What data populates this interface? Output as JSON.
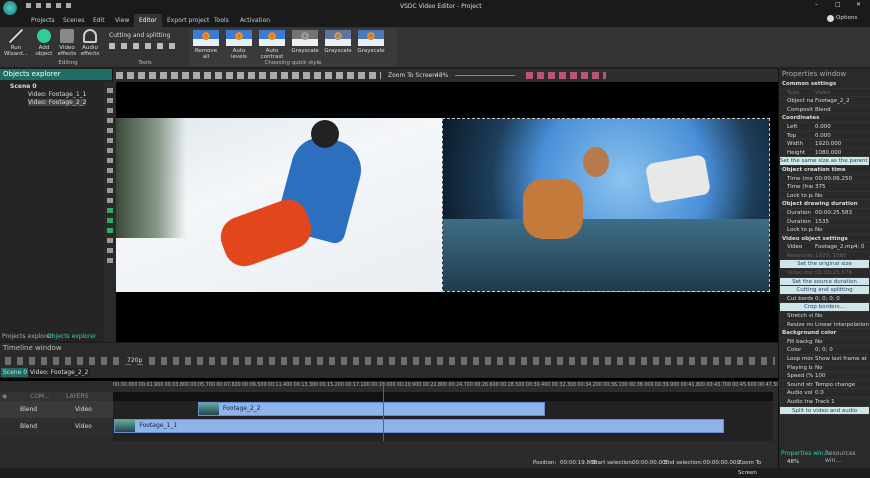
{
  "window": {
    "title": "VSDC Video Editor - Project",
    "options_label": "Options"
  },
  "menu": {
    "tabs": [
      "Projects",
      "Scenes",
      "Edit",
      "View",
      "Editor",
      "Export project",
      "Tools",
      "Activation"
    ],
    "active": "Editor"
  },
  "ribbon": {
    "run_wizard": "Run Wizard...",
    "add_object": "Add object",
    "video_effects": "Video effects",
    "audio_effects": "Audio effects",
    "editing_group": "Editing",
    "cutting": "Cutting and splitting",
    "tools_group": "Tools",
    "quick_styles": [
      "Remove all",
      "Auto levels",
      "Auto contrast",
      "Grayscale",
      "Grayscale",
      "Grayscale"
    ],
    "quick_group": "Choosing quick style"
  },
  "objects_explorer": {
    "title": "Objects explorer",
    "items": [
      "Scene 0",
      "Video: Footage_1_1",
      "Video: Footage_2_2"
    ],
    "tabs": [
      "Projects explorer",
      "Objects explorer"
    ]
  },
  "toolbar": {
    "zoom_label": "Zoom To Screen",
    "zoom_value": "48%"
  },
  "properties": {
    "title": "Properties window",
    "rows": [
      {
        "t": "sec",
        "k": "Common settings"
      },
      {
        "t": "dim",
        "k": "Type",
        "v": "Video"
      },
      {
        "k": "Object name",
        "v": "Footage_2_2"
      },
      {
        "k": "Composition m",
        "v": "Blend"
      },
      {
        "t": "sec",
        "k": "Coordinates"
      },
      {
        "k": "Left",
        "v": "0.000"
      },
      {
        "k": "Top",
        "v": "0.000"
      },
      {
        "k": "Width",
        "v": "1920.000"
      },
      {
        "k": "Height",
        "v": "1080.000"
      },
      {
        "t": "btn",
        "k": "Set the same size as the parent has"
      },
      {
        "t": "sec",
        "k": "Object creation time"
      },
      {
        "k": "Time (ms)",
        "v": "00:00:06.250"
      },
      {
        "k": "Time (frame)",
        "v": "375"
      },
      {
        "k": "Lock to pare",
        "v": "No"
      },
      {
        "t": "sec",
        "k": "Object drawing duration"
      },
      {
        "k": "Duration (ms",
        "v": "00:00:25.583"
      },
      {
        "k": "Duration (fra",
        "v": "1535"
      },
      {
        "k": "Lock to pare",
        "v": "No"
      },
      {
        "t": "sec",
        "k": "Video object settings"
      },
      {
        "k": "Video",
        "v": "Footage_2.mp4; 0"
      },
      {
        "t": "dim",
        "k": "Resolution",
        "v": "1920; 1080"
      },
      {
        "t": "btn",
        "k": "Set the original size"
      },
      {
        "t": "dim",
        "k": "Video duration",
        "v": "00:00:25.579"
      },
      {
        "t": "btn",
        "k": "Set the source duration"
      },
      {
        "t": "btn",
        "k": "Cutting and splitting"
      },
      {
        "k": "Cut borders",
        "v": "0; 0; 0; 0"
      },
      {
        "t": "btn",
        "k": "Crop borders..."
      },
      {
        "k": "Stretch video",
        "v": "No"
      },
      {
        "k": "Resize mode",
        "v": "Linear interpolation"
      },
      {
        "t": "sec",
        "k": "Background color"
      },
      {
        "k": "Fill backgrou",
        "v": "No"
      },
      {
        "k": "Color",
        "v": "0; 0; 0"
      },
      {
        "k": "Loop mode",
        "v": "Show last frame at"
      },
      {
        "k": "Playing backwa",
        "v": "No"
      },
      {
        "k": "Speed (%)",
        "v": "100"
      },
      {
        "k": "Sound stretchin",
        "v": "Tempo change"
      },
      {
        "k": "Audio volume (",
        "v": "0.0"
      },
      {
        "k": "Audio track",
        "v": "Track 1"
      },
      {
        "t": "btn",
        "k": "Split to video and audio"
      }
    ],
    "tabs": [
      "Properties win...",
      "Resources win..."
    ],
    "zoom": "48%"
  },
  "timeline": {
    "title": "Timeline window",
    "resolution": "720p",
    "tabs": [
      "Scene 0",
      "Video: Footage_2_2"
    ],
    "layers_header": {
      "com": "COM...",
      "layers": "LAYERS"
    },
    "ruler": [
      "00:00.000",
      "00:01.900",
      "00:03.800",
      "00:05.700",
      "00:07.600",
      "00:09.500",
      "00:11.400",
      "00:13.300",
      "00:15.200",
      "00:17.100",
      "00:19.000",
      "00:20.900",
      "00:22.800",
      "00:24.700",
      "00:26.600",
      "00:28.500",
      "00:30.400",
      "00:32.300",
      "00:34.200",
      "00:36.100",
      "00:38.000",
      "00:39.900",
      "00:41.800",
      "00:43.700",
      "00:45.600",
      "00:47.500"
    ],
    "tracks": [
      {
        "blend": "Blend",
        "type": "Video",
        "clip": "Footage_2_2",
        "start_s": 6.25,
        "end_s": 31.833
      },
      {
        "blend": "Blend",
        "type": "Video",
        "clip": "Footage_1_1",
        "start_s": 0.1,
        "end_s": 45.0
      }
    ],
    "playhead_s": 19.866
  },
  "status": {
    "position_label": "Position:",
    "position": "00:00:19.866",
    "start_label": "Start selection:",
    "start": "00:00:00.000",
    "end_label": "End selection:",
    "end": "00:00:00.000",
    "zoom_label": "Zoom To Screen",
    "zoom": "48%"
  }
}
